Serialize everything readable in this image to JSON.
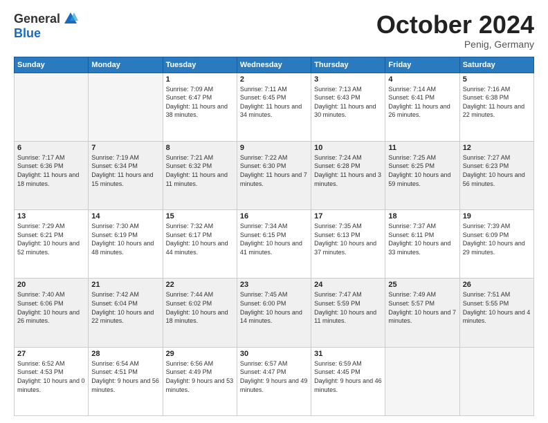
{
  "header": {
    "logo_general": "General",
    "logo_blue": "Blue",
    "month": "October 2024",
    "location": "Penig, Germany"
  },
  "days_of_week": [
    "Sunday",
    "Monday",
    "Tuesday",
    "Wednesday",
    "Thursday",
    "Friday",
    "Saturday"
  ],
  "weeks": [
    [
      {
        "day": "",
        "info": ""
      },
      {
        "day": "",
        "info": ""
      },
      {
        "day": "1",
        "info": "Sunrise: 7:09 AM\nSunset: 6:47 PM\nDaylight: 11 hours and 38 minutes."
      },
      {
        "day": "2",
        "info": "Sunrise: 7:11 AM\nSunset: 6:45 PM\nDaylight: 11 hours and 34 minutes."
      },
      {
        "day": "3",
        "info": "Sunrise: 7:13 AM\nSunset: 6:43 PM\nDaylight: 11 hours and 30 minutes."
      },
      {
        "day": "4",
        "info": "Sunrise: 7:14 AM\nSunset: 6:41 PM\nDaylight: 11 hours and 26 minutes."
      },
      {
        "day": "5",
        "info": "Sunrise: 7:16 AM\nSunset: 6:38 PM\nDaylight: 11 hours and 22 minutes."
      }
    ],
    [
      {
        "day": "6",
        "info": "Sunrise: 7:17 AM\nSunset: 6:36 PM\nDaylight: 11 hours and 18 minutes."
      },
      {
        "day": "7",
        "info": "Sunrise: 7:19 AM\nSunset: 6:34 PM\nDaylight: 11 hours and 15 minutes."
      },
      {
        "day": "8",
        "info": "Sunrise: 7:21 AM\nSunset: 6:32 PM\nDaylight: 11 hours and 11 minutes."
      },
      {
        "day": "9",
        "info": "Sunrise: 7:22 AM\nSunset: 6:30 PM\nDaylight: 11 hours and 7 minutes."
      },
      {
        "day": "10",
        "info": "Sunrise: 7:24 AM\nSunset: 6:28 PM\nDaylight: 11 hours and 3 minutes."
      },
      {
        "day": "11",
        "info": "Sunrise: 7:25 AM\nSunset: 6:25 PM\nDaylight: 10 hours and 59 minutes."
      },
      {
        "day": "12",
        "info": "Sunrise: 7:27 AM\nSunset: 6:23 PM\nDaylight: 10 hours and 56 minutes."
      }
    ],
    [
      {
        "day": "13",
        "info": "Sunrise: 7:29 AM\nSunset: 6:21 PM\nDaylight: 10 hours and 52 minutes."
      },
      {
        "day": "14",
        "info": "Sunrise: 7:30 AM\nSunset: 6:19 PM\nDaylight: 10 hours and 48 minutes."
      },
      {
        "day": "15",
        "info": "Sunrise: 7:32 AM\nSunset: 6:17 PM\nDaylight: 10 hours and 44 minutes."
      },
      {
        "day": "16",
        "info": "Sunrise: 7:34 AM\nSunset: 6:15 PM\nDaylight: 10 hours and 41 minutes."
      },
      {
        "day": "17",
        "info": "Sunrise: 7:35 AM\nSunset: 6:13 PM\nDaylight: 10 hours and 37 minutes."
      },
      {
        "day": "18",
        "info": "Sunrise: 7:37 AM\nSunset: 6:11 PM\nDaylight: 10 hours and 33 minutes."
      },
      {
        "day": "19",
        "info": "Sunrise: 7:39 AM\nSunset: 6:09 PM\nDaylight: 10 hours and 29 minutes."
      }
    ],
    [
      {
        "day": "20",
        "info": "Sunrise: 7:40 AM\nSunset: 6:06 PM\nDaylight: 10 hours and 26 minutes."
      },
      {
        "day": "21",
        "info": "Sunrise: 7:42 AM\nSunset: 6:04 PM\nDaylight: 10 hours and 22 minutes."
      },
      {
        "day": "22",
        "info": "Sunrise: 7:44 AM\nSunset: 6:02 PM\nDaylight: 10 hours and 18 minutes."
      },
      {
        "day": "23",
        "info": "Sunrise: 7:45 AM\nSunset: 6:00 PM\nDaylight: 10 hours and 14 minutes."
      },
      {
        "day": "24",
        "info": "Sunrise: 7:47 AM\nSunset: 5:59 PM\nDaylight: 10 hours and 11 minutes."
      },
      {
        "day": "25",
        "info": "Sunrise: 7:49 AM\nSunset: 5:57 PM\nDaylight: 10 hours and 7 minutes."
      },
      {
        "day": "26",
        "info": "Sunrise: 7:51 AM\nSunset: 5:55 PM\nDaylight: 10 hours and 4 minutes."
      }
    ],
    [
      {
        "day": "27",
        "info": "Sunrise: 6:52 AM\nSunset: 4:53 PM\nDaylight: 10 hours and 0 minutes."
      },
      {
        "day": "28",
        "info": "Sunrise: 6:54 AM\nSunset: 4:51 PM\nDaylight: 9 hours and 56 minutes."
      },
      {
        "day": "29",
        "info": "Sunrise: 6:56 AM\nSunset: 4:49 PM\nDaylight: 9 hours and 53 minutes."
      },
      {
        "day": "30",
        "info": "Sunrise: 6:57 AM\nSunset: 4:47 PM\nDaylight: 9 hours and 49 minutes."
      },
      {
        "day": "31",
        "info": "Sunrise: 6:59 AM\nSunset: 4:45 PM\nDaylight: 9 hours and 46 minutes."
      },
      {
        "day": "",
        "info": ""
      },
      {
        "day": "",
        "info": ""
      }
    ]
  ]
}
